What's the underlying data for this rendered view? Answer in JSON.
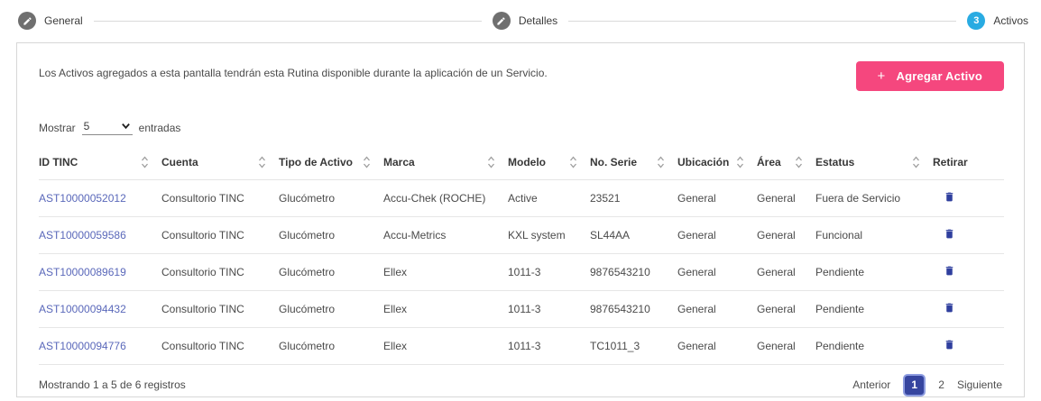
{
  "stepper": {
    "steps": [
      {
        "label": "General",
        "state": "done"
      },
      {
        "label": "Detalles",
        "state": "done"
      },
      {
        "label": "Activos",
        "state": "active",
        "number": "3"
      }
    ]
  },
  "panel": {
    "description": "Los Activos agregados a esta pantalla tendrán esta Rutina disponible durante la aplicación de un Servicio.",
    "add_button_icon": "+",
    "add_button_label": "Agregar Activo"
  },
  "table_controls": {
    "show_label": "Mostrar",
    "page_size": "5",
    "entries_label": "entradas"
  },
  "table": {
    "columns": [
      "ID TINC",
      "Cuenta",
      "Tipo de Activo",
      "Marca",
      "Modelo",
      "No. Serie",
      "Ubicación",
      "Área",
      "Estatus",
      "Retirar"
    ],
    "rows": [
      [
        "AST10000052012",
        "Consultorio TINC",
        "Glucómetro",
        "Accu-Chek (ROCHE)",
        "Active",
        "23521",
        "General",
        "General",
        "Fuera de Servicio"
      ],
      [
        "AST10000059586",
        "Consultorio TINC",
        "Glucómetro",
        "Accu-Metrics",
        "KXL system",
        "SL44AA",
        "General",
        "General",
        "Funcional"
      ],
      [
        "AST10000089619",
        "Consultorio TINC",
        "Glucómetro",
        "Ellex",
        "1011-3",
        "9876543210",
        "General",
        "General",
        "Pendiente"
      ],
      [
        "AST10000094432",
        "Consultorio TINC",
        "Glucómetro",
        "Ellex",
        "1011-3",
        "9876543210",
        "General",
        "General",
        "Pendiente"
      ],
      [
        "AST10000094776",
        "Consultorio TINC",
        "Glucómetro",
        "Ellex",
        "1011-3",
        "TC1011_3",
        "General",
        "General",
        "Pendiente"
      ]
    ]
  },
  "footer": {
    "summary": "Mostrando 1 a 5 de 6 registros",
    "prev_label": "Anterior",
    "pages": [
      "1",
      "2"
    ],
    "active_page": "1",
    "next_label": "Siguiente"
  },
  "colors": {
    "accent_pink": "#f5477e",
    "step_active_blue": "#29abe2",
    "step_done_gray": "#6f6f6f",
    "active_page_indigo": "#36459f",
    "id_link_indigo": "#5a68ba",
    "trash_indigo": "#2f3f9e"
  }
}
